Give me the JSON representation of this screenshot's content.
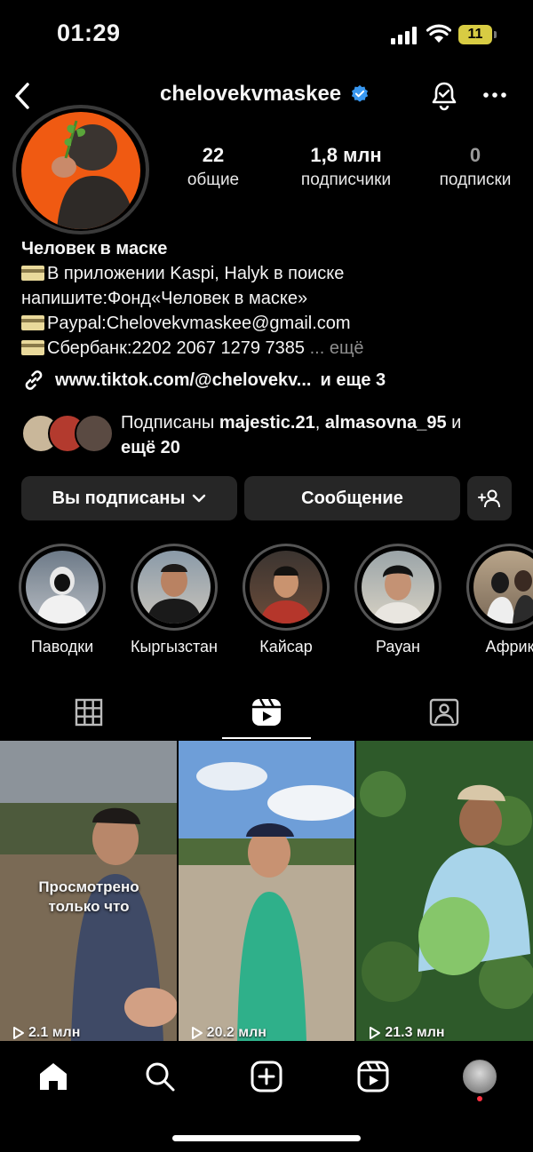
{
  "status": {
    "time": "01:29",
    "battery": "11"
  },
  "header": {
    "username": "chelovekvmaskee"
  },
  "stats": [
    {
      "num": "22",
      "label": "общие"
    },
    {
      "num": "1,8 млн",
      "label": "подписчики"
    },
    {
      "num": "0",
      "label": "подписки"
    }
  ],
  "bio": {
    "name": "Человек в маске",
    "line1": "В приложении Kaspi, Halyk в поиске",
    "line2": "напишите:Фонд«Человек в маске»",
    "line3": "Paypal:Chelovekvmaskee@gmail.com",
    "line4": "Сбербанк:2202 2067 1279 7385",
    "more": "... ещё"
  },
  "link": {
    "text": "www.tiktok.com/@chelovekv...",
    "extra": "и еще 3"
  },
  "mutual": {
    "prefix": "Подписаны",
    "user1": "majestic.21",
    "sep": ",",
    "user2": "almasovna_95",
    "and": "и",
    "rest": "ещё 20"
  },
  "actions": {
    "following": "Вы подписаны",
    "message": "Сообщение"
  },
  "highlights": [
    {
      "label": "Паводки"
    },
    {
      "label": "Кыргызстан"
    },
    {
      "label": "Кайсар"
    },
    {
      "label": "Рауан"
    },
    {
      "label": "Африк"
    }
  ],
  "reels": [
    {
      "views": "2.1 млн",
      "overlay_line1": "Просмотрено",
      "overlay_line2": "только что"
    },
    {
      "views": "20.2 млн"
    },
    {
      "views": "21.3 млн"
    }
  ],
  "colors": {
    "verified": "#3897f0",
    "notification_dot": "#ff3040",
    "battery": "#d8cc43"
  }
}
